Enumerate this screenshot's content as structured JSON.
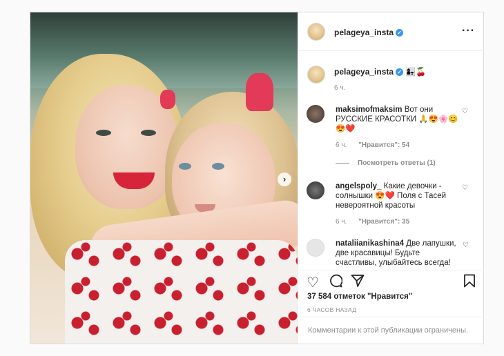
{
  "post": {
    "author": "pelageya_insta",
    "verified_icon": "verified-badge-icon",
    "more_icon": "more-options-icon",
    "carousel_next_icon": "chevron-right-icon"
  },
  "caption": {
    "username": "pelageya_insta",
    "text": "👩‍👧🍒",
    "time": "6 ч."
  },
  "comments": [
    {
      "username": "maksimofmaksim",
      "text": "Вот они РУССКИЕ КРАСОТКИ 🙏😍🌸😊😍❤️",
      "time": "6 ч.",
      "likes": "\"Нравится\": 54",
      "replies": "Посмотреть ответы (1)"
    },
    {
      "username": "angelspoly_",
      "text": "Какие девочки - солнышки 😍❤️ Поля с Тасей невероятной красоты",
      "time": "6 ч.",
      "likes": "\"Нравится\": 35"
    },
    {
      "username": "nataliianikashina4",
      "text": "Две лапушки, две красавицы! Будьте счастливы, улыбайтесь всегда!",
      "time": "",
      "likes": ""
    }
  ],
  "actions": {
    "like_icon": "heart-icon",
    "comment_icon": "comment-icon",
    "share_icon": "send-icon",
    "save_icon": "bookmark-icon"
  },
  "likes_count": "37 584 отметок \"Нравится\"",
  "posted_time": "6 ЧАСОВ НАЗАД",
  "restricted_text": "Комментарии к этой публикации ограничены."
}
